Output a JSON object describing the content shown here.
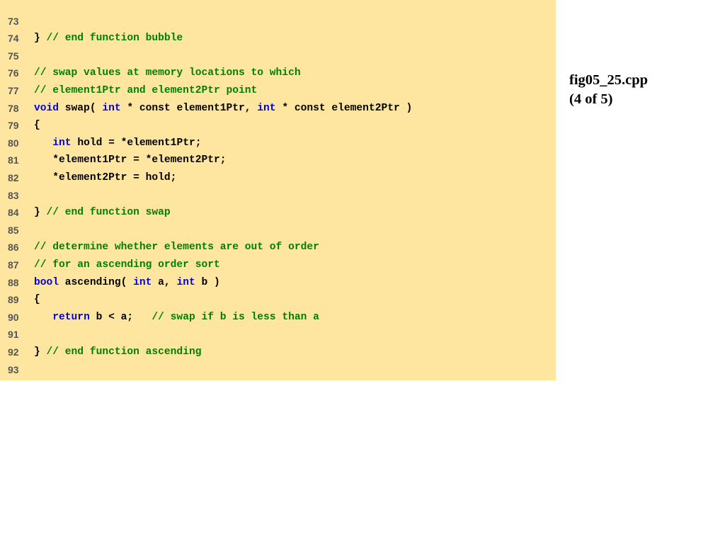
{
  "caption": {
    "filename": "fig05_25.cpp",
    "page": "(4 of 5)"
  },
  "colors": {
    "background": "#FFE6A0",
    "keyword": "#0000E6",
    "comment": "#008000",
    "plain": "#000000",
    "line_number": "#555555"
  },
  "code_lines": [
    {
      "num": "73",
      "tokens": []
    },
    {
      "num": "74",
      "tokens": [
        {
          "t": "} ",
          "c": "plain"
        },
        {
          "t": "// end function bubble",
          "c": "comment"
        }
      ]
    },
    {
      "num": "75",
      "tokens": []
    },
    {
      "num": "76",
      "tokens": [
        {
          "t": "// swap values at memory locations to which",
          "c": "comment"
        }
      ]
    },
    {
      "num": "77",
      "tokens": [
        {
          "t": "// element1Ptr and element2Ptr point",
          "c": "comment"
        }
      ]
    },
    {
      "num": "78",
      "tokens": [
        {
          "t": "void",
          "c": "keyword"
        },
        {
          "t": " swap( ",
          "c": "plain"
        },
        {
          "t": "int",
          "c": "keyword"
        },
        {
          "t": " * const element1Ptr, ",
          "c": "plain"
        },
        {
          "t": "int",
          "c": "keyword"
        },
        {
          "t": " * const element2Ptr )",
          "c": "plain"
        }
      ]
    },
    {
      "num": "79",
      "tokens": [
        {
          "t": "{",
          "c": "plain"
        }
      ]
    },
    {
      "num": "80",
      "tokens": [
        {
          "t": "   ",
          "c": "plain"
        },
        {
          "t": "int",
          "c": "keyword"
        },
        {
          "t": " hold = *element1Ptr;",
          "c": "plain"
        }
      ]
    },
    {
      "num": "81",
      "tokens": [
        {
          "t": "   *element1Ptr = *element2Ptr;",
          "c": "plain"
        }
      ]
    },
    {
      "num": "82",
      "tokens": [
        {
          "t": "   *element2Ptr = hold;",
          "c": "plain"
        }
      ]
    },
    {
      "num": "83",
      "tokens": []
    },
    {
      "num": "84",
      "tokens": [
        {
          "t": "} ",
          "c": "plain"
        },
        {
          "t": "// end function swap",
          "c": "comment"
        }
      ]
    },
    {
      "num": "85",
      "tokens": []
    },
    {
      "num": "86",
      "tokens": [
        {
          "t": "// determine whether elements are out of order",
          "c": "comment"
        }
      ]
    },
    {
      "num": "87",
      "tokens": [
        {
          "t": "// for an ascending order sort",
          "c": "comment"
        }
      ]
    },
    {
      "num": "88",
      "tokens": [
        {
          "t": "bool",
          "c": "keyword"
        },
        {
          "t": " ascending( ",
          "c": "plain"
        },
        {
          "t": "int",
          "c": "keyword"
        },
        {
          "t": " a, ",
          "c": "plain"
        },
        {
          "t": "int",
          "c": "keyword"
        },
        {
          "t": " b )",
          "c": "plain"
        }
      ]
    },
    {
      "num": "89",
      "tokens": [
        {
          "t": "{",
          "c": "plain"
        }
      ]
    },
    {
      "num": "90",
      "tokens": [
        {
          "t": "   ",
          "c": "plain"
        },
        {
          "t": "return",
          "c": "keyword"
        },
        {
          "t": " b < a;   ",
          "c": "plain"
        },
        {
          "t": "// swap if b is less than a",
          "c": "comment"
        }
      ]
    },
    {
      "num": "91",
      "tokens": []
    },
    {
      "num": "92",
      "tokens": [
        {
          "t": "} ",
          "c": "plain"
        },
        {
          "t": "// end function ascending",
          "c": "comment"
        }
      ]
    },
    {
      "num": "93",
      "tokens": []
    }
  ]
}
